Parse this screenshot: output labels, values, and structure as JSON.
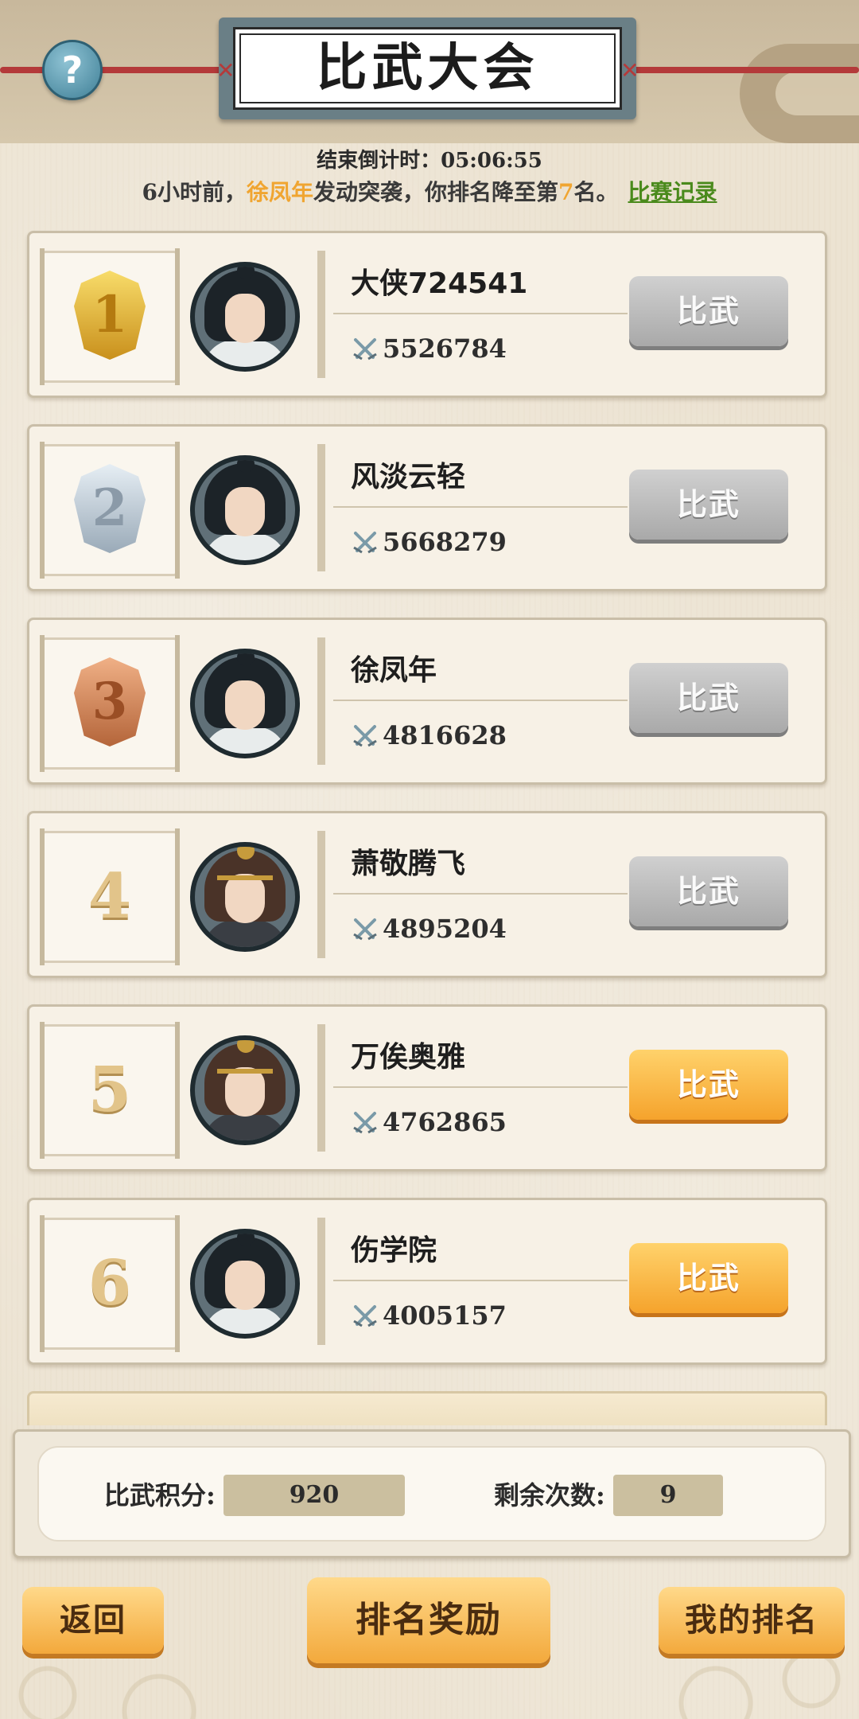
{
  "header": {
    "title": "比武大会",
    "help_icon": "?"
  },
  "countdown": {
    "label": "结束倒计时：",
    "time": "05:06:55"
  },
  "news": {
    "prefix": "6小时前，",
    "attacker": "徐凤年",
    "middle": "发动突袭，你排名降至第",
    "rank": "7",
    "suffix": "名。",
    "record_link": "比赛记录"
  },
  "players": [
    {
      "rank": "1",
      "name": "大侠724541",
      "power": "5526784",
      "button": "比武",
      "button_state": "gray",
      "avatar": "black-hair"
    },
    {
      "rank": "2",
      "name": "风淡云轻",
      "power": "5668279",
      "button": "比武",
      "button_state": "gray",
      "avatar": "black-hair"
    },
    {
      "rank": "3",
      "name": "徐凤年",
      "power": "4816628",
      "button": "比武",
      "button_state": "gray",
      "avatar": "black-hair"
    },
    {
      "rank": "4",
      "name": "萧敬腾飞",
      "power": "4895204",
      "button": "比武",
      "button_state": "gray",
      "avatar": "brown-hair"
    },
    {
      "rank": "5",
      "name": "万俟奥雅",
      "power": "4762865",
      "button": "比武",
      "button_state": "orange",
      "avatar": "brown-hair"
    },
    {
      "rank": "6",
      "name": "伤学院",
      "power": "4005157",
      "button": "比武",
      "button_state": "orange",
      "avatar": "black-hair"
    }
  ],
  "stats": {
    "score_label": "比武积分:",
    "score_value": "920",
    "remaining_label": "剩余次数:",
    "remaining_value": "9"
  },
  "bottom": {
    "back": "返回",
    "rewards": "排名奖励",
    "my_rank": "我的排名"
  },
  "colors": {
    "accent_orange": "#f5a32c",
    "link_green": "#4a8a1c",
    "highlight": "#f0a531",
    "rope_red": "#b43a3a"
  }
}
